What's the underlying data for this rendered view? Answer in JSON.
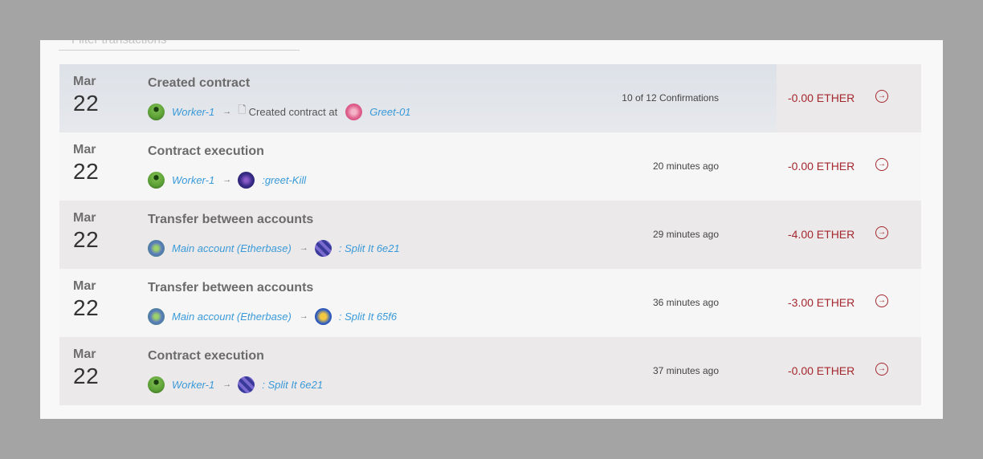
{
  "filter": {
    "placeholder": "Filter transactions"
  },
  "transactions": [
    {
      "month": "Mar",
      "day": "22",
      "title": "Created contract",
      "from": "Worker-1",
      "action": "Created contract at",
      "to": "Greet-01",
      "status": "10 of 12 Confirmations",
      "amount": "-0.00 ETHER"
    },
    {
      "month": "Mar",
      "day": "22",
      "title": "Contract execution",
      "from": "Worker-1",
      "to": ":greet-Kill",
      "status": "20 minutes ago",
      "amount": "-0.00 ETHER"
    },
    {
      "month": "Mar",
      "day": "22",
      "title": "Transfer between accounts",
      "from": "Main account (Etherbase)",
      "to": ": Split It 6e21",
      "status": "29 minutes ago",
      "amount": "-4.00 ETHER"
    },
    {
      "month": "Mar",
      "day": "22",
      "title": "Transfer between accounts",
      "from": "Main account (Etherbase)",
      "to": ": Split It 65f6",
      "status": "36 minutes ago",
      "amount": "-3.00 ETHER"
    },
    {
      "month": "Mar",
      "day": "22",
      "title": "Contract execution",
      "from": "Worker-1",
      "to": ": Split It 6e21",
      "status": "37 minutes ago",
      "amount": "-0.00 ETHER"
    }
  ],
  "icons": {
    "arrow": "arrow-right-icon",
    "doc": "document-icon",
    "go": "circle-arrow-right-icon"
  },
  "colors": {
    "link": "#3a9ad9",
    "amount": "#a4282e"
  }
}
